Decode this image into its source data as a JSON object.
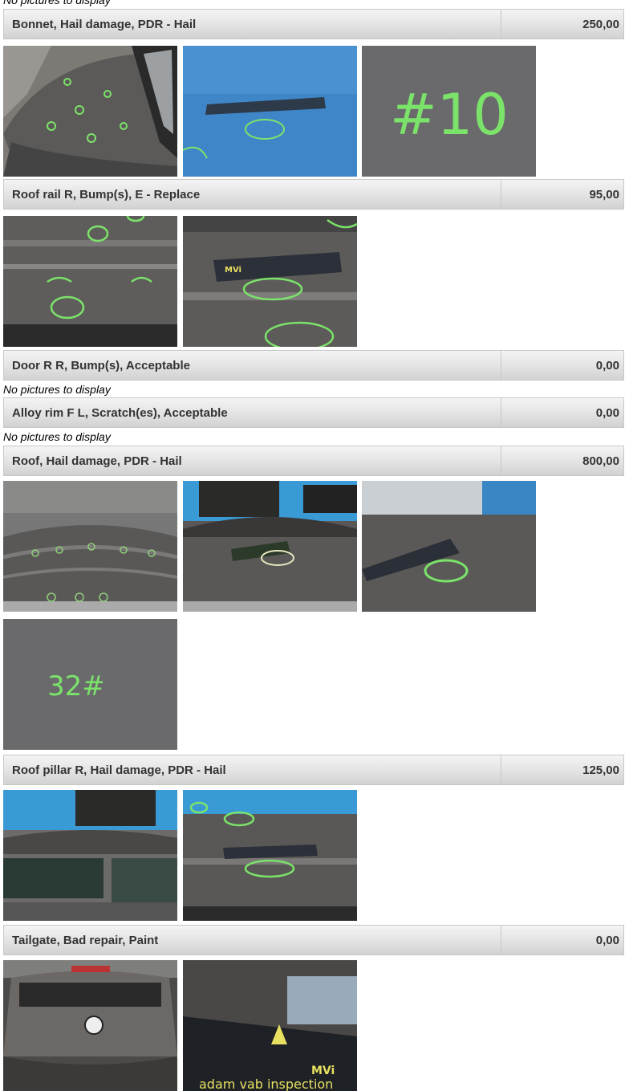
{
  "no_pictures_text": "No pictures to display",
  "items": [
    {
      "label": "Bonnet, Hail damage, PDR - Hail",
      "amount": "250,00"
    },
    {
      "label": "Roof rail R, Bump(s), E - Replace",
      "amount": "95,00"
    },
    {
      "label": "Door R R, Bump(s), Acceptable",
      "amount": "0,00"
    },
    {
      "label": "Alloy rim F L, Scratch(es), Acceptable",
      "amount": "0,00"
    },
    {
      "label": "Roof, Hail damage, PDR - Hail",
      "amount": "800,00"
    },
    {
      "label": "Roof pillar R, Hail damage, PDR - Hail",
      "amount": "125,00"
    },
    {
      "label": "Tailgate, Bad repair, Paint",
      "amount": "0,00"
    }
  ],
  "photo_marks": {
    "bonnet_3": "#10",
    "roof_4": "32#",
    "ruler_brand": "MVi",
    "ruler_text": "adam vab inspection"
  },
  "colors": {
    "marker_green": "#7be36a",
    "car_body": "#5c5a58",
    "sky_blue": "#3f86c9",
    "surface_grey": "#6a6a6c"
  }
}
